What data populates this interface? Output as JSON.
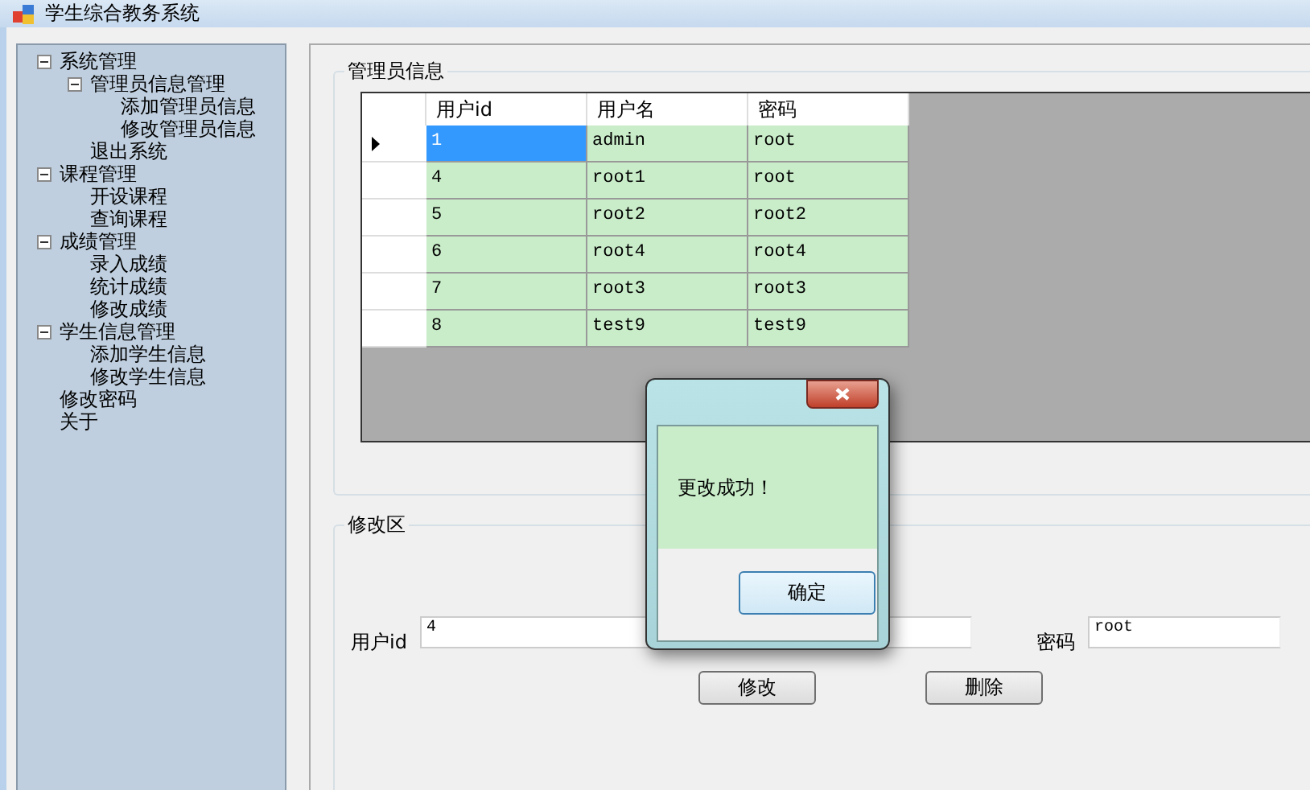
{
  "window": {
    "title": "学生综合教务系统"
  },
  "tree": [
    {
      "label": "系统管理",
      "expanded": true,
      "children": [
        {
          "label": "管理员信息管理",
          "expanded": true,
          "children": [
            {
              "label": "添加管理员信息"
            },
            {
              "label": "修改管理员信息"
            }
          ]
        },
        {
          "label": "退出系统"
        }
      ]
    },
    {
      "label": "课程管理",
      "expanded": true,
      "children": [
        {
          "label": "开设课程"
        },
        {
          "label": "查询课程"
        }
      ]
    },
    {
      "label": "成绩管理",
      "expanded": true,
      "children": [
        {
          "label": "录入成绩"
        },
        {
          "label": "统计成绩"
        },
        {
          "label": "修改成绩"
        }
      ]
    },
    {
      "label": "学生信息管理",
      "expanded": true,
      "children": [
        {
          "label": "添加学生信息"
        },
        {
          "label": "修改学生信息"
        }
      ]
    },
    {
      "label": "修改密码"
    },
    {
      "label": "关于"
    }
  ],
  "admin_group": {
    "title": "管理员信息",
    "table": {
      "columns": [
        "用户id",
        "用户名",
        "密码"
      ],
      "rows": [
        {
          "cells": [
            "1",
            "admin",
            "root"
          ],
          "selected": true
        },
        {
          "cells": [
            "4",
            "root1",
            "root"
          ],
          "selected": false
        },
        {
          "cells": [
            "5",
            "root2",
            "root2"
          ],
          "selected": false
        },
        {
          "cells": [
            "6",
            "root4",
            "root4"
          ],
          "selected": false
        },
        {
          "cells": [
            "7",
            "root3",
            "root3"
          ],
          "selected": false
        },
        {
          "cells": [
            "8",
            "test9",
            "test9"
          ],
          "selected": false
        }
      ]
    }
  },
  "edit_group": {
    "title": "修改区",
    "fields": [
      {
        "kind": "textbox",
        "label": "用户id",
        "value": "4"
      },
      {
        "kind": "textbox"
      },
      {
        "kind": "textbox",
        "label": "密码",
        "value": "root"
      }
    ],
    "buttons": [
      "修改",
      "删除"
    ]
  },
  "dialog": {
    "message": "更改成功！",
    "button": "确定"
  }
}
